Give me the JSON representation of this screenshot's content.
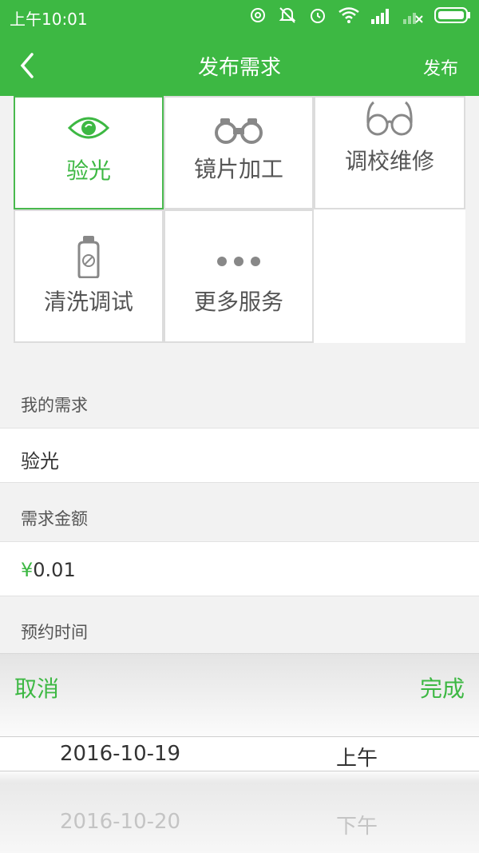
{
  "status_bar": {
    "time": "上午10:01",
    "icons": [
      "sync-icon",
      "mute-icon",
      "alarm-icon",
      "wifi-icon",
      "signal-icon",
      "no-signal-icon",
      "battery-icon"
    ],
    "color": "#3db843"
  },
  "nav": {
    "back_icon": "chevron-left-icon",
    "title": "发布需求",
    "action": "发布"
  },
  "services": [
    {
      "label": "验光",
      "icon": "eye-icon",
      "selected": true
    },
    {
      "label": "镜片加工",
      "icon": "binoculars-icon",
      "selected": false
    },
    {
      "label": "调校维修",
      "icon": "glasses-icon",
      "selected": false
    },
    {
      "label": "清洗调试",
      "icon": "spray-bottle-icon",
      "selected": false
    },
    {
      "label": "更多服务",
      "icon": "more-dots-icon",
      "selected": false
    }
  ],
  "form": {
    "demand_title": "我的需求",
    "demand_value": "验光",
    "amount_title": "需求金额",
    "amount_currency": "¥",
    "amount_value": "0.01",
    "time_title": "预约时间"
  },
  "picker": {
    "cancel": "取消",
    "done": "完成",
    "rows": [
      {
        "date": "2016-10-19",
        "period": "上午"
      },
      {
        "date": "2016-10-20",
        "period": "下午"
      }
    ]
  },
  "colors": {
    "accent": "#3db843",
    "background": "#f2f2f2"
  }
}
